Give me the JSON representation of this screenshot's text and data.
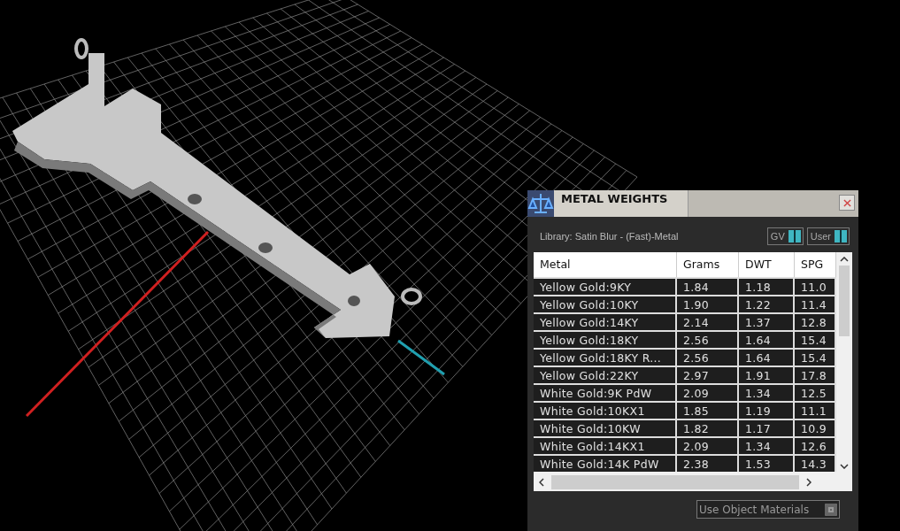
{
  "panel": {
    "title": "METAL WEIGHTS",
    "library": "Library: Satin Blur - (Fast)-Metal",
    "toggles": [
      {
        "label": "GV",
        "on": true
      },
      {
        "label": "User",
        "on": true
      }
    ],
    "table": {
      "columns": [
        "Metal",
        "Grams",
        "DWT",
        "SPG"
      ],
      "rows": [
        [
          "Yellow Gold:9KY",
          "1.84",
          "1.18",
          "11.0"
        ],
        [
          "Yellow Gold:10KY",
          "1.90",
          "1.22",
          "11.4"
        ],
        [
          "Yellow Gold:14KY",
          "2.14",
          "1.37",
          "12.8"
        ],
        [
          "Yellow Gold:18KY",
          "2.56",
          "1.64",
          "15.4"
        ],
        [
          "Yellow Gold:18KY R...",
          "2.56",
          "1.64",
          "15.4"
        ],
        [
          "Yellow Gold:22KY",
          "2.97",
          "1.91",
          "17.8"
        ],
        [
          "White Gold:9K PdW",
          "2.09",
          "1.34",
          "12.5"
        ],
        [
          "White Gold:10KX1",
          "1.85",
          "1.19",
          "11.1"
        ],
        [
          "White Gold:10KW",
          "1.82",
          "1.17",
          "10.9"
        ],
        [
          "White Gold:14KX1",
          "2.09",
          "1.34",
          "12.6"
        ],
        [
          "White Gold:14K PdW",
          "2.38",
          "1.53",
          "14.3"
        ]
      ]
    },
    "button": "Use Object Materials"
  }
}
